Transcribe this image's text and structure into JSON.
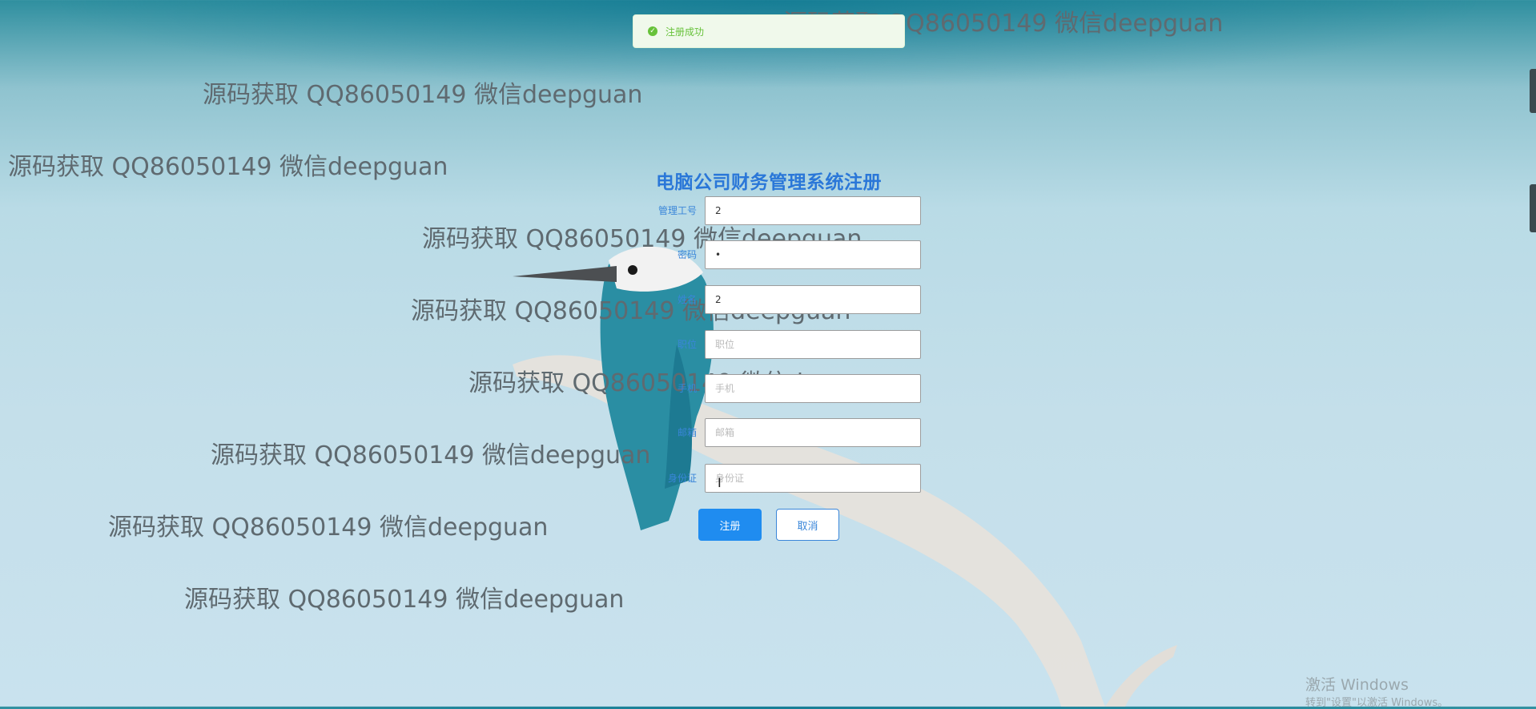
{
  "toast": {
    "message": "注册成功",
    "icon": "check-circle-icon",
    "color": "#67c23a"
  },
  "form": {
    "title": "电脑公司财务管理系统注册",
    "fields": [
      {
        "label": "管理工号",
        "value": "2",
        "placeholder": "管理工号"
      },
      {
        "label": "密码",
        "value": "•",
        "placeholder": "密码"
      },
      {
        "label": "姓名",
        "value": "2",
        "placeholder": "姓名"
      },
      {
        "label": "职位",
        "value": "",
        "placeholder": "职位"
      },
      {
        "label": "手机",
        "value": "",
        "placeholder": "手机"
      },
      {
        "label": "邮箱",
        "value": "",
        "placeholder": "邮箱"
      },
      {
        "label": "身份证",
        "value": "",
        "placeholder": "身份证"
      }
    ],
    "register_label": "注册",
    "cancel_label": "取消"
  },
  "watermark_text": "源码获取 QQ86050149 微信deepguan",
  "windows": {
    "activate_title": "激活 Windows",
    "activate_sub": "转到\"设置\"以激活 Windows。"
  },
  "colors": {
    "accent": "#1f8cf0",
    "label_blue": "#3a86d9",
    "success": "#67c23a"
  }
}
